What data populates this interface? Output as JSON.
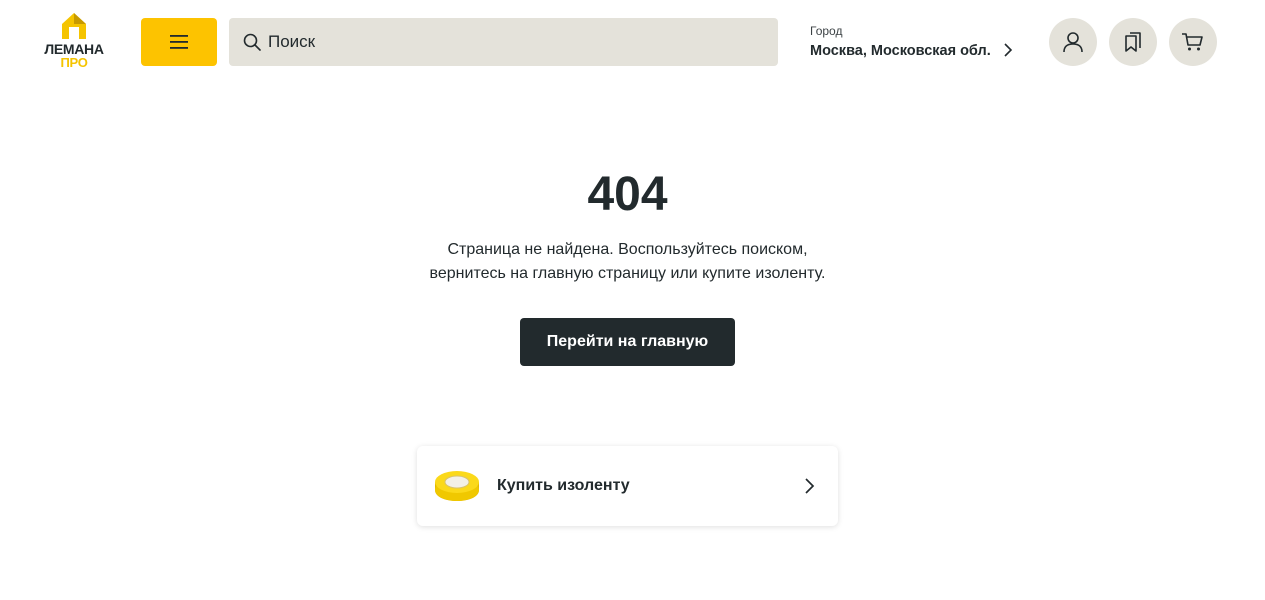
{
  "logo": {
    "line1": "ЛЕМАНА",
    "line2": "ПРО"
  },
  "header": {
    "menu_icon": "hamburger-icon",
    "search": {
      "placeholder": "Поиск",
      "value": "",
      "icon": "search-icon"
    },
    "city": {
      "label": "Город",
      "value": "Москва, Московская обл.",
      "icon": "chevron-right-icon"
    },
    "actions": [
      {
        "name": "profile",
        "icon": "user-icon"
      },
      {
        "name": "bookmarks",
        "icon": "bookmark-icon"
      },
      {
        "name": "cart",
        "icon": "cart-icon"
      }
    ]
  },
  "error": {
    "code": "404",
    "message_line1": "Страница не найдена. Воспользуйтесь поиском,",
    "message_line2": "вернитесь на главную страницу или купите изоленту.",
    "home_button": "Перейти на главную"
  },
  "tape_card": {
    "label": "Купить изоленту",
    "image": "insulating-tape-image",
    "icon": "chevron-right-icon"
  },
  "colors": {
    "brand_yellow": "#fdc300",
    "dark": "#222a2d",
    "search_bg": "#e4e2da",
    "white": "#ffffff"
  }
}
